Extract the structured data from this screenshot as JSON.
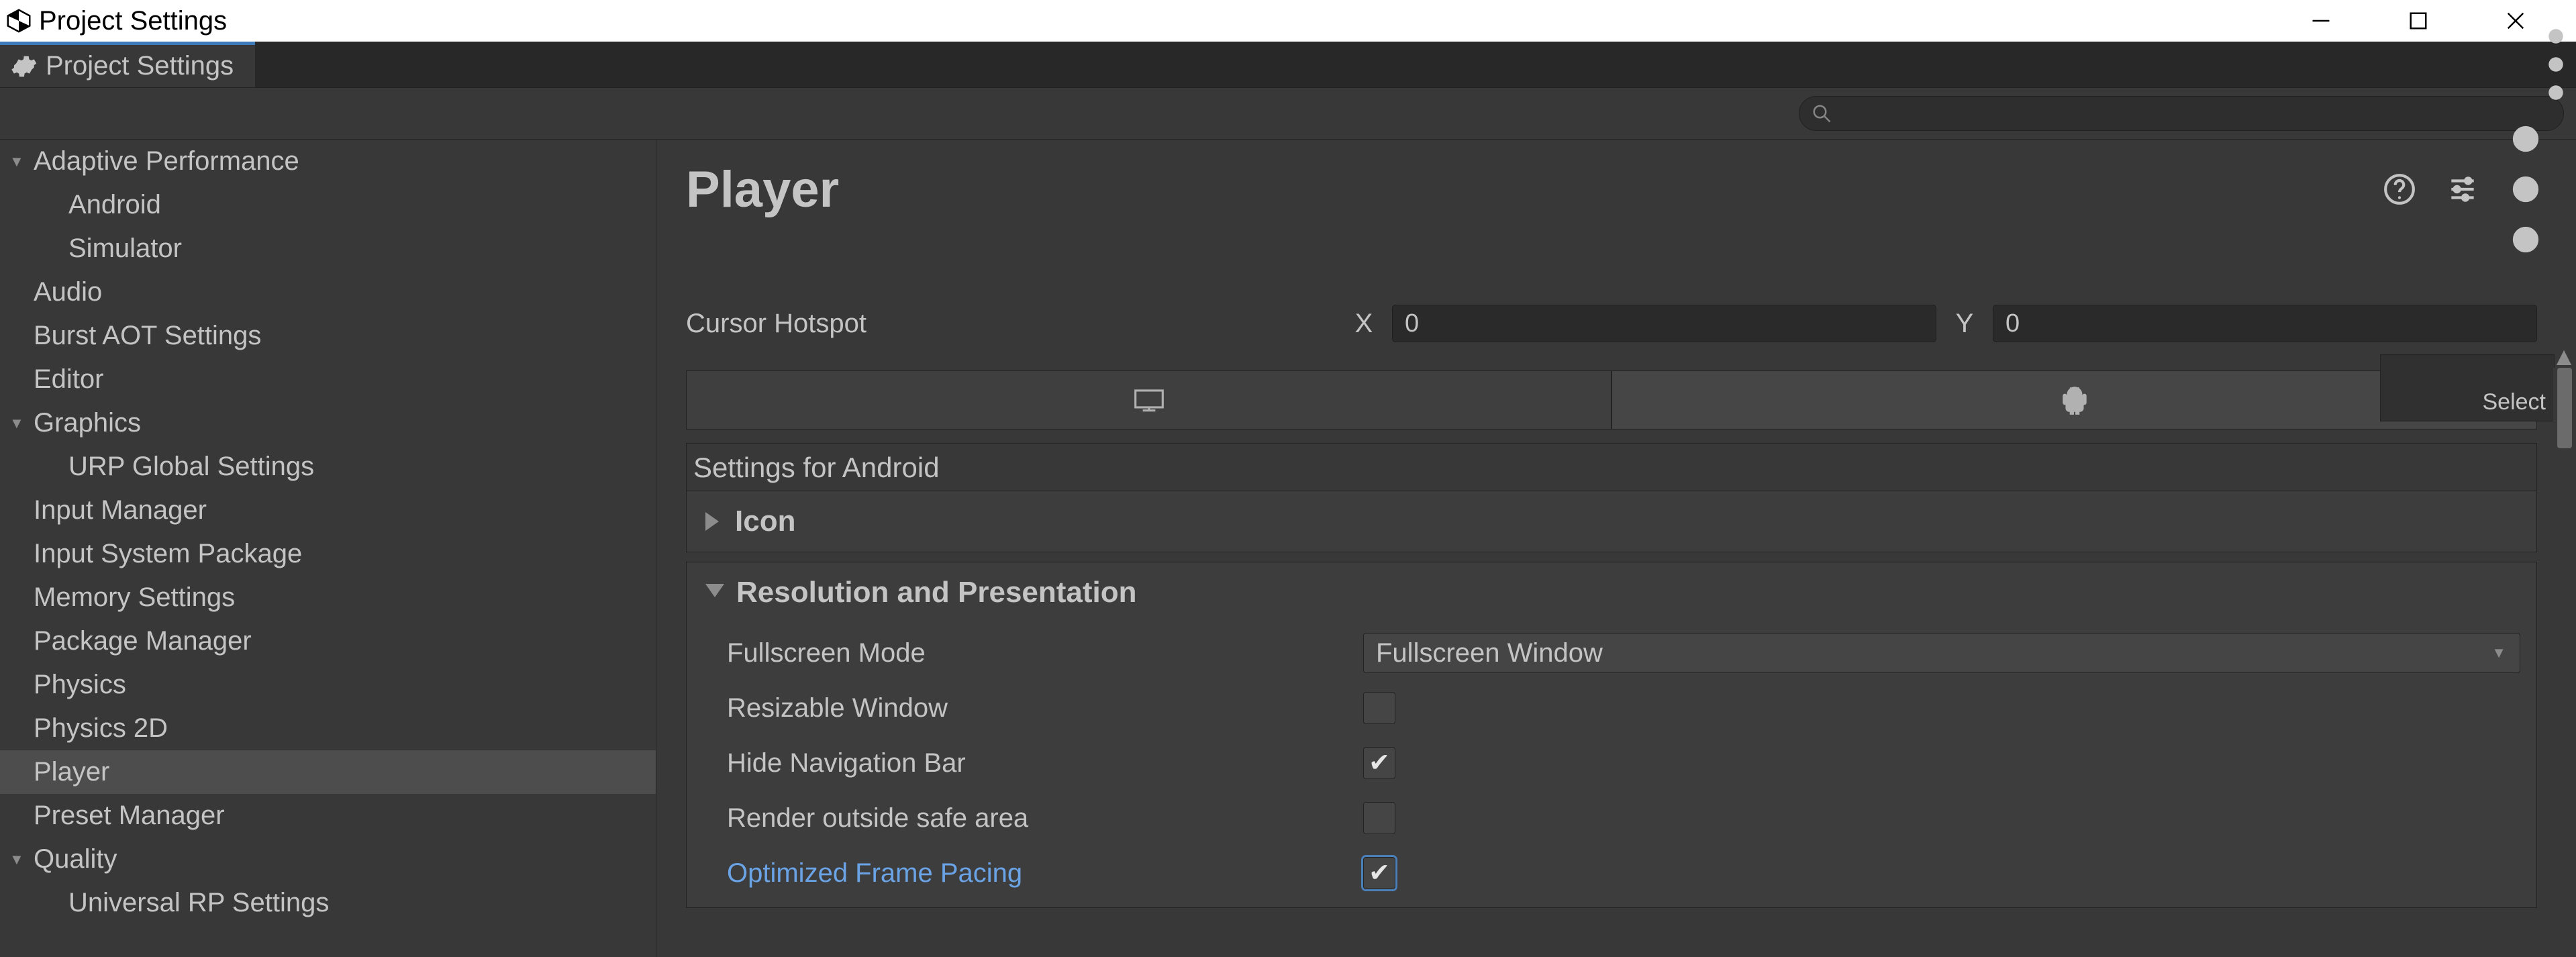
{
  "window": {
    "title": "Project Settings"
  },
  "tab": {
    "label": "Project Settings"
  },
  "search": {
    "placeholder": ""
  },
  "sidebar": {
    "items": [
      {
        "label": "Adaptive Performance",
        "parent": true
      },
      {
        "label": "Android",
        "indent": true
      },
      {
        "label": "Simulator",
        "indent": true
      },
      {
        "label": "Audio"
      },
      {
        "label": "Burst AOT Settings"
      },
      {
        "label": "Editor"
      },
      {
        "label": "Graphics",
        "parent": true
      },
      {
        "label": "URP Global Settings",
        "indent": true
      },
      {
        "label": "Input Manager"
      },
      {
        "label": "Input System Package"
      },
      {
        "label": "Memory Settings"
      },
      {
        "label": "Package Manager"
      },
      {
        "label": "Physics"
      },
      {
        "label": "Physics 2D"
      },
      {
        "label": "Player",
        "selected": true
      },
      {
        "label": "Preset Manager"
      },
      {
        "label": "Quality",
        "parent": true
      },
      {
        "label": "Universal RP Settings",
        "indent": true
      }
    ]
  },
  "content": {
    "title": "Player",
    "selectBox": "Select",
    "cursor": {
      "label": "Cursor Hotspot",
      "xLabel": "X",
      "yLabel": "Y",
      "x": "0",
      "y": "0"
    },
    "platformSection": "Settings for Android",
    "iconSection": "Icon",
    "resSection": {
      "title": "Resolution and Presentation",
      "fullscreenMode": {
        "label": "Fullscreen Mode",
        "value": "Fullscreen Window"
      },
      "resizable": {
        "label": "Resizable Window",
        "checked": false
      },
      "hideNav": {
        "label": "Hide Navigation Bar",
        "checked": true
      },
      "renderOutside": {
        "label": "Render outside safe area",
        "checked": false
      },
      "optimizedPacing": {
        "label": "Optimized Frame Pacing",
        "checked": true
      }
    }
  }
}
